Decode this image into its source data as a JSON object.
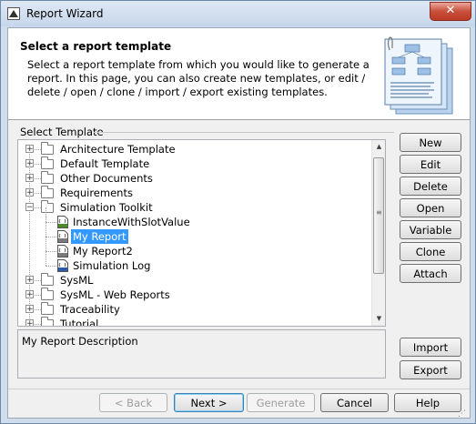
{
  "window": {
    "title": "Report Wizard",
    "close_label": "✕"
  },
  "header": {
    "title": "Select a report template",
    "description": "Select a report template from which you would like to generate a report. In this page, you can also create new templates, or edit / delete / open / clone / import / export existing templates."
  },
  "select_template": {
    "group_label": "Select Template",
    "tree": [
      {
        "label": "Architecture Template",
        "type": "folder",
        "expanded": false
      },
      {
        "label": "Default Template",
        "type": "folder",
        "expanded": false
      },
      {
        "label": "Other Documents",
        "type": "folder",
        "expanded": false
      },
      {
        "label": "Requirements",
        "type": "folder",
        "expanded": false
      },
      {
        "label": "Simulation Toolkit",
        "type": "folder",
        "expanded": true
      },
      {
        "label": "InstanceWithSlotValue",
        "type": "file-html"
      },
      {
        "label": "My Report",
        "type": "file",
        "selected": true
      },
      {
        "label": "My Report2",
        "type": "file"
      },
      {
        "label": "Simulation Log",
        "type": "file-docx"
      },
      {
        "label": "SysML",
        "type": "folder",
        "expanded": false
      },
      {
        "label": "SysML - Web Reports",
        "type": "folder",
        "expanded": false
      },
      {
        "label": "Traceability",
        "type": "folder",
        "expanded": false
      },
      {
        "label": "Tutorial",
        "type": "folder",
        "expanded": false
      }
    ],
    "description_text": "My Report Description"
  },
  "side_buttons": {
    "new": "New",
    "edit": "Edit",
    "delete": "Delete",
    "open": "Open",
    "variable": "Variable",
    "clone": "Clone",
    "attach": "Attach",
    "import": "Import",
    "export": "Export"
  },
  "footer_buttons": {
    "back": "< Back",
    "next": "Next >",
    "generate": "Generate",
    "cancel": "Cancel",
    "help": "Help"
  },
  "colors": {
    "selection": "#3399ff",
    "titlebar": "#c6d6ea",
    "close": "#c9503c"
  },
  "icons": [
    "app-icon",
    "close-icon",
    "folder-icon",
    "html-file-icon",
    "template-file-icon",
    "docx-file-icon",
    "expand-icon",
    "collapse-icon",
    "template-stack-illustration",
    "resize-grip-icon"
  ]
}
